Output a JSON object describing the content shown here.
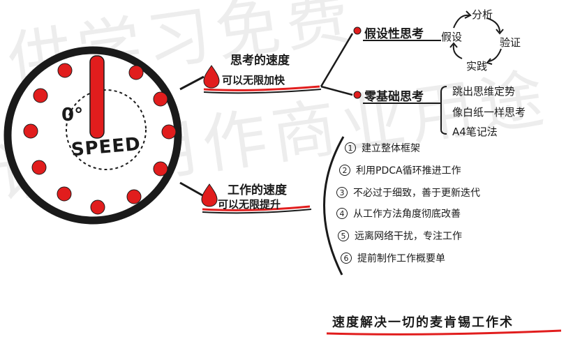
{
  "watermark": {
    "line1": "供学习免费",
    "line2": "请勿用作商业用途"
  },
  "clock": {
    "zero_label": "0°",
    "speed_label": "SPEED"
  },
  "thinking": {
    "title": "思考的速度",
    "subtitle": "可以无限加快",
    "branches": [
      {
        "label": "假设性思考",
        "cycle": [
          "分析",
          "验证",
          "实践",
          "假设"
        ]
      },
      {
        "label": "零基础思考",
        "items": [
          "跳出思维定势",
          "像白纸一样思考",
          "A4笔记法"
        ]
      }
    ]
  },
  "work": {
    "title": "工作的速度",
    "subtitle": "可以无限提升",
    "items": [
      {
        "num": "1",
        "text": "建立整体框架"
      },
      {
        "num": "2",
        "text": "利用PDCA循环推进工作"
      },
      {
        "num": "3",
        "text": "不必过于细致，善于更新迭代"
      },
      {
        "num": "4",
        "text": "从工作方法角度彻底改善"
      },
      {
        "num": "5",
        "text": "远离网络干扰，专注工作"
      },
      {
        "num": "6",
        "text": "提前制作工作概要单"
      }
    ]
  },
  "footer": {
    "title": "速度解决一切的麦肯锡工作术"
  },
  "colors": {
    "accent": "#e11d1d",
    "ink": "#1a1a1a"
  }
}
